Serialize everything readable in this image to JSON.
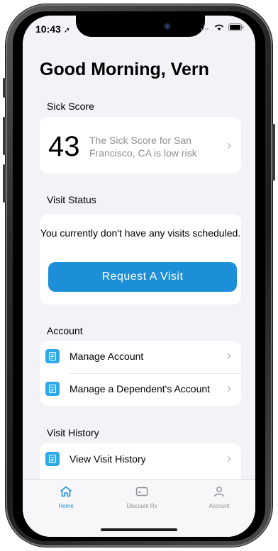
{
  "status_bar": {
    "time": "10:43"
  },
  "greeting": "Good Morning, Vern",
  "sick_score": {
    "section_label": "Sick Score",
    "score": "43",
    "description": "The Sick Score for San Francisco, CA is low risk"
  },
  "visit_status": {
    "section_label": "Visit Status",
    "message": "You currently don't have any visits scheduled.",
    "button_label": "Request A Visit"
  },
  "account": {
    "section_label": "Account",
    "items": [
      {
        "label": "Manage Account"
      },
      {
        "label": "Manage a Dependent's Account"
      }
    ]
  },
  "visit_history": {
    "section_label": "Visit History",
    "items": [
      {
        "label": "View Visit History"
      }
    ]
  },
  "tab_bar": {
    "tabs": [
      {
        "label": "Home",
        "icon": "home-icon",
        "active": true
      },
      {
        "label": "Discount Rx",
        "icon": "card-icon",
        "active": false
      },
      {
        "label": "Account",
        "icon": "person-icon",
        "active": false
      }
    ]
  },
  "colors": {
    "accent": "#1c8fd8",
    "background": "#f2f2f7",
    "icon_blue": "#2ea8e6"
  }
}
